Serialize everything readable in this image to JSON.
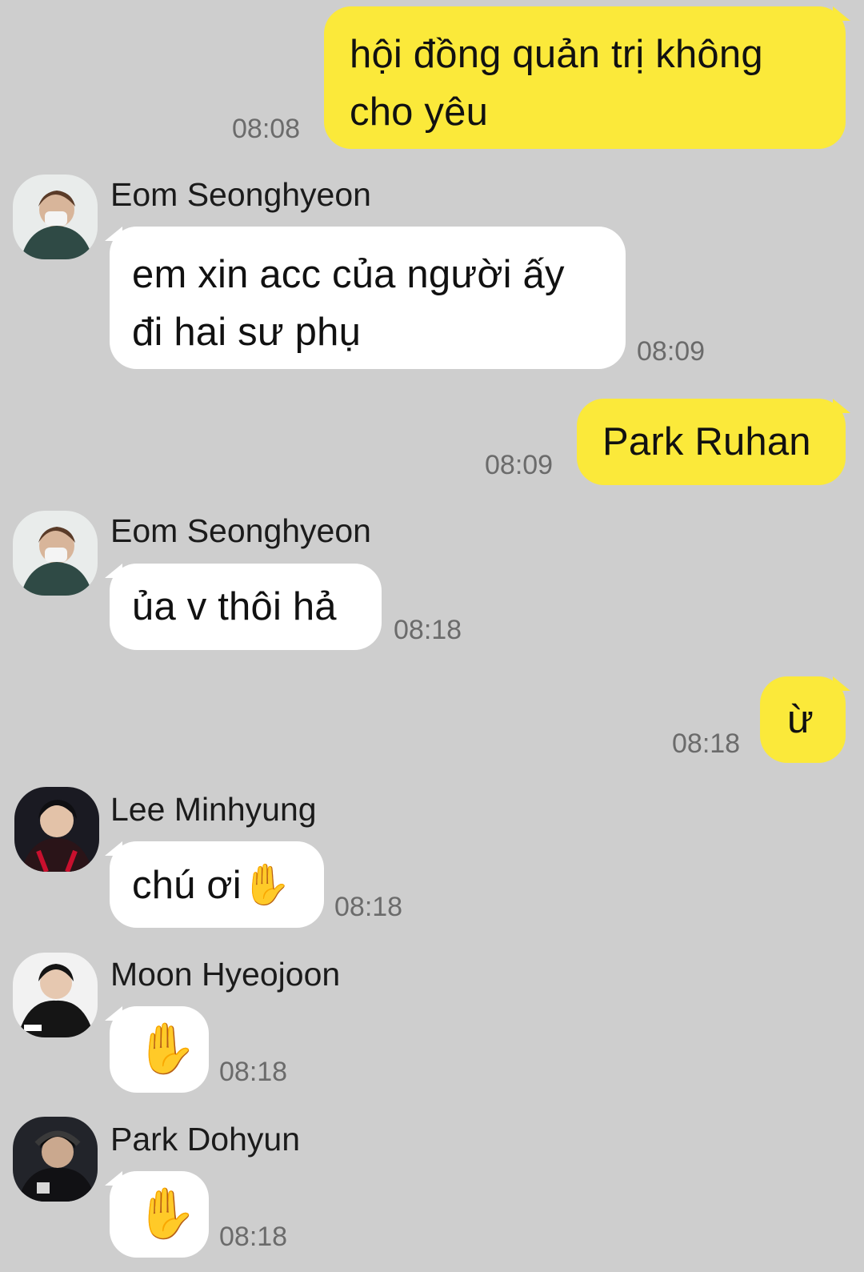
{
  "messages": [
    {
      "id": "m1",
      "lines": [
        "hội đồng quản trị không",
        "cho yêu"
      ],
      "time": "08:08"
    },
    {
      "id": "m2",
      "sender": "Eom Seonghyeon",
      "lines": [
        "em xin acc của người ấy",
        "đi hai sư phụ"
      ],
      "time": "08:09"
    },
    {
      "id": "m3",
      "text": "Park Ruhan",
      "time": "08:09"
    },
    {
      "id": "m4",
      "sender": "Eom Seonghyeon",
      "text": "ủa v thôi hả",
      "time": "08:18"
    },
    {
      "id": "m5",
      "text": "ừ",
      "time": "08:18"
    },
    {
      "id": "m6",
      "sender": "Lee Minhyung",
      "text": "chú ơi",
      "emoji": "✋",
      "time": "08:18"
    },
    {
      "id": "m7",
      "sender": "Moon Hyeojoon",
      "emoji": "✋",
      "time": "08:18"
    },
    {
      "id": "m8",
      "sender": "Park Dohyun",
      "emoji": "✋",
      "time": "08:18"
    }
  ],
  "colors": {
    "background": "#cecece",
    "outgoing_bubble": "#fbe93a",
    "incoming_bubble": "#ffffff",
    "timestamp": "#6b6b6b"
  },
  "icons": {
    "avatar": "profile-photo",
    "emoji": "raised-hand-emoji"
  }
}
